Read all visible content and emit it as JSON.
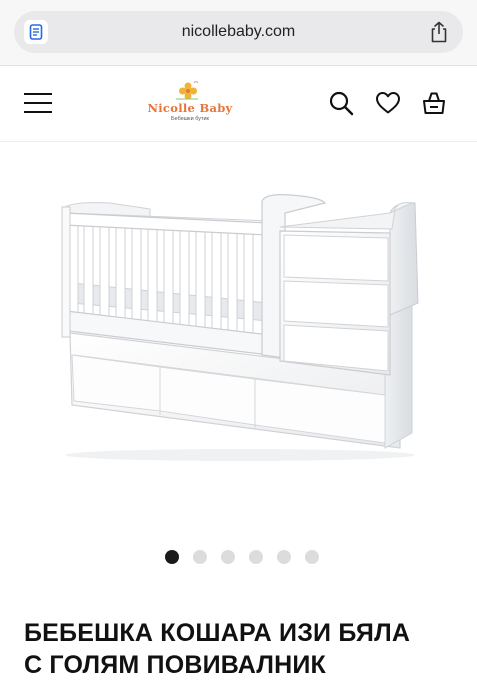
{
  "browser": {
    "url": "nicollebaby.com",
    "page_icon": "document-icon",
    "share_icon": "share-icon"
  },
  "header": {
    "logo_text": "Nicolle Baby",
    "logo_subtitle": "Бебешки бутик",
    "icons": [
      "menu-icon",
      "search-icon",
      "heart-icon",
      "bag-icon"
    ],
    "brand_color": "#e8743a"
  },
  "gallery": {
    "image_subject": "white convertible baby crib with changing dresser",
    "total_slides": 6,
    "active_slide": 1
  },
  "product": {
    "title_line1": "БЕБЕШКА КОШАРА ИЗИ БЯЛА",
    "title_line2": "С ГОЛЯМ ПОВИВАЛНИК"
  }
}
